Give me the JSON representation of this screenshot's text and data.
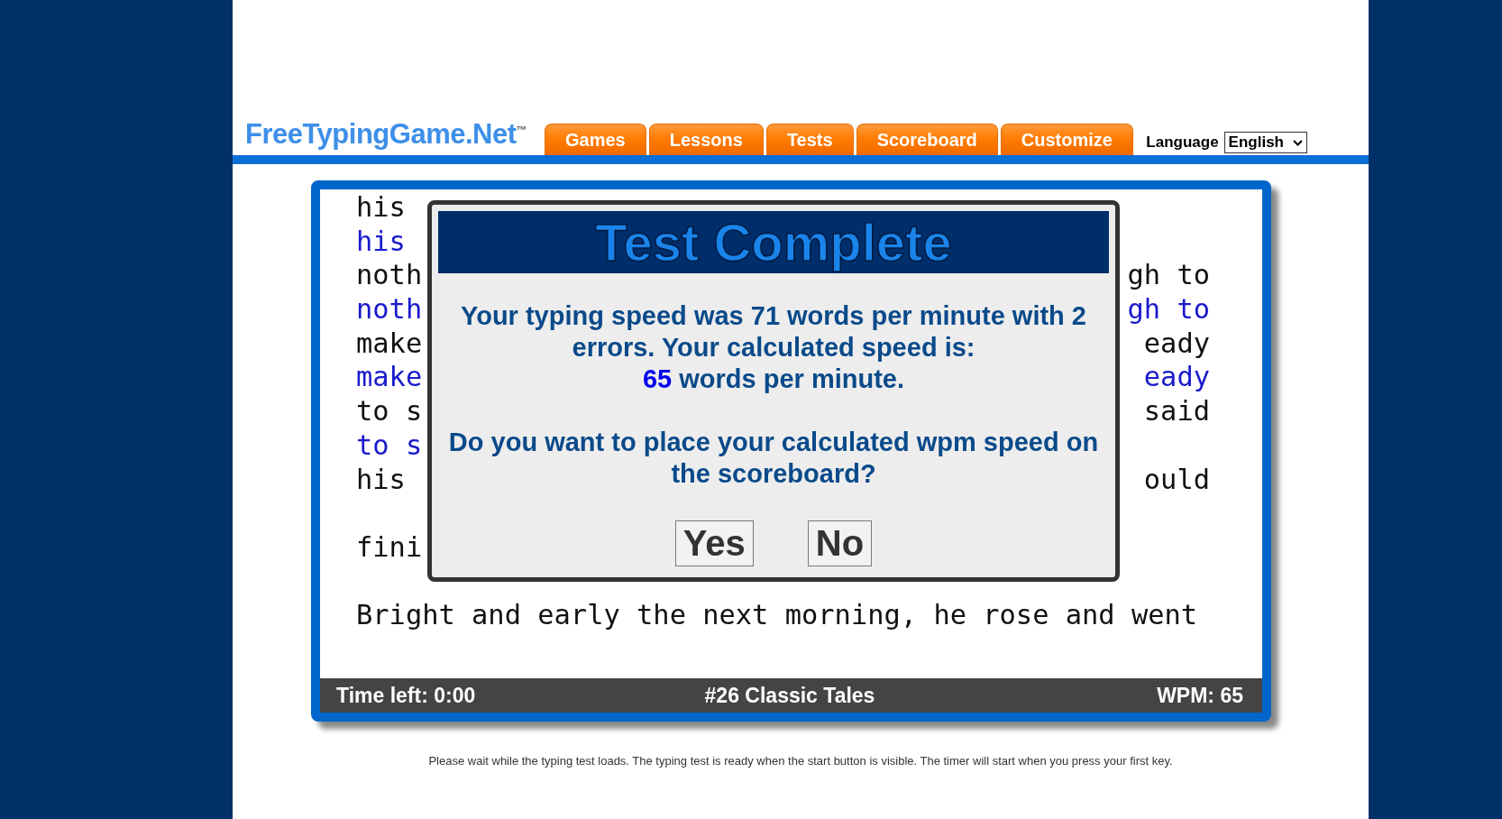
{
  "logo": {
    "text": "FreeTypingGame.Net$^{™}$"
  },
  "nav_tabs": [
    {
      "label": "Games"
    },
    {
      "label": "Lessons"
    },
    {
      "label": "Tests"
    },
    {
      "label": "Scoreboard"
    },
    {
      "label": "Customize"
    }
  ],
  "language": {
    "label": "Language",
    "value": "English"
  },
  "test_text": {
    "lines": [
      {
        "kind": "text",
        "left": "his",
        "typed": false
      },
      {
        "kind": "text",
        "left": "his",
        "typed": true
      },
      {
        "kind": "text",
        "left": "noth",
        "right": "gh to",
        "typed": false
      },
      {
        "kind": "text",
        "left": "noth",
        "right": "gh to",
        "typed": true
      },
      {
        "kind": "text",
        "left": "make",
        "right": "eady",
        "typed": false
      },
      {
        "kind": "text",
        "left": "make",
        "right": "eady",
        "typed": true
      },
      {
        "kind": "text",
        "left": "to s",
        "right": "said",
        "typed": false
      },
      {
        "kind": "text",
        "left": "to s",
        "typed": true
      },
      {
        "kind": "text",
        "left": "his",
        "right": "ould",
        "typed": false
      },
      {
        "kind": "blank"
      },
      {
        "kind": "text",
        "left": "fini",
        "typed": false
      },
      {
        "kind": "blank"
      },
      {
        "kind": "text",
        "left": "Bright and early the next morning, he rose and went",
        "typed": false
      }
    ]
  },
  "status_bar": {
    "time_left": "Time left: 0:00",
    "title": "#26 Classic Tales",
    "wpm": "WPM: 65"
  },
  "dialog": {
    "title": "Test Complete",
    "message": "Your typing speed was 71 words per minute with 2 errors. Your calculated speed is:",
    "score": "65",
    "score_suffix": "words per minute.",
    "question": "Do you want to place your calculated wpm speed on the scoreboard?",
    "buttons": [
      "Yes",
      "No"
    ]
  },
  "footer": "Please wait while the typing test loads. The typing test is ready when the start button is visible. The timer will start when you press your first key."
}
